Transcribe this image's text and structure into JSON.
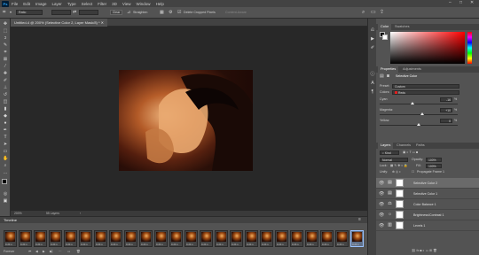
{
  "app": {
    "logo_text": "Ps"
  },
  "menu": [
    "File",
    "Edit",
    "Image",
    "Layer",
    "Type",
    "Select",
    "Filter",
    "3D",
    "View",
    "Window",
    "Help"
  ],
  "window_controls": {
    "minimize": "–",
    "maximize": "□",
    "close": "✕"
  },
  "options_bar": {
    "ratio_label": "Ratio",
    "clear_label": "Clear",
    "straighten_label": "Straighten",
    "delete_cropped_label": "Delete Cropped Pixels",
    "content_aware_label": "Content-Aware"
  },
  "document": {
    "tab_title": "Untitled-4 @ 200% (Selective Color 2, Layer Mask/8) *",
    "zoom": "200%",
    "status_info": "55 Layers"
  },
  "timeline": {
    "title": "Timeline",
    "frame_delays": [
      "0.24 s",
      "0.24 s",
      "0.24 s",
      "0.24 s",
      "0.24 s",
      "0.24 s",
      "0.24 s",
      "0.24 s",
      "0.24 s",
      "0.24 s",
      "0.24 s",
      "0.24 s",
      "0.24 s",
      "0.24 s",
      "0.24 s",
      "0.24 s",
      "0.24 s",
      "0.24 s",
      "0.24 s",
      "0.24 s",
      "0.24 s",
      "0.24 s",
      "0.24 s",
      "0.24 s"
    ],
    "loop_label": "Forever"
  },
  "color_panel": {
    "tabs": [
      "Color",
      "Swatches"
    ],
    "foreground": "#000000",
    "background": "#ffffff"
  },
  "properties": {
    "tabs": [
      "Properties",
      "Adjustments"
    ],
    "title": "Selective Color",
    "preset_label": "Preset:",
    "preset_value": "Custom",
    "colors_label": "Colors:",
    "colors_value": "Reds",
    "cyan_label": "Cyan:",
    "cyan_value": "-16",
    "cyan_pct": 0.42,
    "magenta_label": "Magenta:",
    "magenta_value": "+10",
    "magenta_pct": 0.55,
    "yellow_label": "Yellow:",
    "yellow_value": "0",
    "yellow_pct": 0.5,
    "unit": "%"
  },
  "layers_panel": {
    "tabs": [
      "Layers",
      "Channels",
      "Paths"
    ],
    "kind_label": "Kind",
    "blend_mode": "Normal",
    "opacity_label": "Opacity:",
    "opacity_value": "100%",
    "lock_label": "Lock:",
    "fill_label": "Fill:",
    "fill_value": "100%",
    "propagate_label": "Propagate Frame 1",
    "layers": [
      {
        "name": "Selective Color 2",
        "icon": "▤",
        "active": true
      },
      {
        "name": "Selective Color 1",
        "icon": "▤",
        "active": false
      },
      {
        "name": "Color Balance 1",
        "icon": "⚖",
        "active": false
      },
      {
        "name": "Brightness/Contrast 1",
        "icon": "☼",
        "active": false
      },
      {
        "name": "Levels 1",
        "icon": "▥",
        "active": false
      }
    ]
  },
  "colors": {
    "accent": "#31a8ff",
    "panel": "#535353",
    "canvas": "#282828"
  }
}
